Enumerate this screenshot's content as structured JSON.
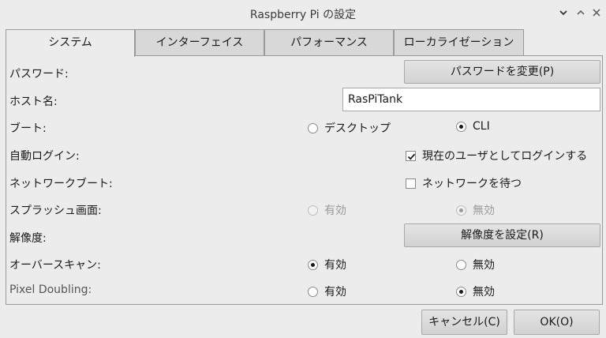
{
  "window": {
    "title": "Raspberry Pi の設定"
  },
  "tabs": [
    {
      "label": "システム",
      "active": true
    },
    {
      "label": "インターフェイス",
      "active": false
    },
    {
      "label": "パフォーマンス",
      "active": false
    },
    {
      "label": "ローカライゼーション",
      "active": false
    }
  ],
  "system": {
    "password": {
      "label": "パスワード:",
      "button": "パスワードを変更(P)"
    },
    "hostname": {
      "label": "ホスト名:",
      "value": "RasPiTank"
    },
    "boot": {
      "label": "ブート:",
      "option_desktop": "デスクトップ",
      "option_cli": "CLI",
      "selected": "CLI"
    },
    "autologin": {
      "label": "自動ログイン:",
      "checkbox": "現在のユーザとしてログインする",
      "checked": true
    },
    "network_boot": {
      "label": "ネットワークブート:",
      "checkbox": "ネットワークを待つ",
      "checked": false
    },
    "splash": {
      "label": "スプラッシュ画面:",
      "option_on": "有効",
      "option_off": "無効",
      "selected": "無効",
      "disabled": true
    },
    "resolution": {
      "label": "解像度:",
      "button": "解像度を設定(R)"
    },
    "overscan": {
      "label": "オーバースキャン:",
      "option_on": "有効",
      "option_off": "無効",
      "selected": "有効"
    },
    "pixel_doubling": {
      "label": "Pixel Doubling:",
      "option_on": "有効",
      "option_off": "無効",
      "selected": "無効"
    }
  },
  "footer": {
    "cancel": "キャンセル(C)",
    "ok": "OK(O)"
  }
}
